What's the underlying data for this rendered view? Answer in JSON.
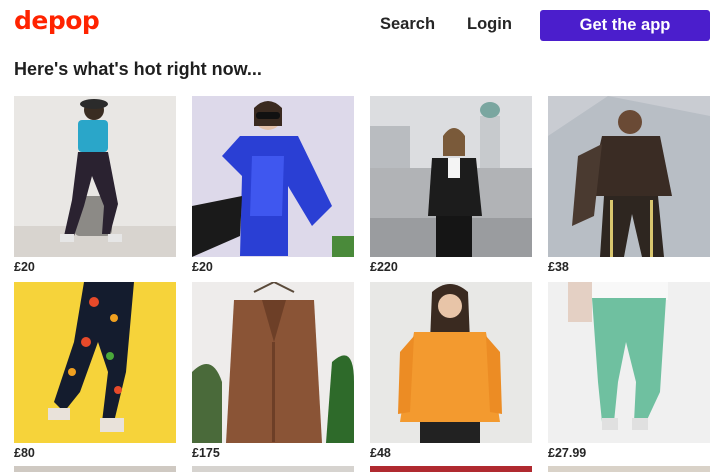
{
  "header": {
    "logo": "depop",
    "nav": [
      {
        "label": "Search"
      },
      {
        "label": "Login"
      }
    ],
    "cta": "Get the app"
  },
  "section": {
    "title": "Here's what's hot right now..."
  },
  "products": [
    {
      "price": "£20",
      "description": "woman in blue cropped tee and black trousers sitting on keg"
    },
    {
      "price": "£20",
      "description": "person in blue satin shirt with sunglasses"
    },
    {
      "price": "£220",
      "description": "woman in black puffer jacket on rooftop"
    },
    {
      "price": "£38",
      "description": "person in brown leather jacket and tracksuit"
    },
    {
      "price": "£80",
      "description": "cherry print trousers with platform heels on yellow"
    },
    {
      "price": "£175",
      "description": "brown wool overcoat on hanger"
    },
    {
      "price": "£48",
      "description": "woman in orange half-zip sweatshirt"
    },
    {
      "price": "£27.99",
      "description": "mint green corduroy trousers"
    }
  ],
  "colors": {
    "brand": "#ff2300",
    "cta_bg": "#4b1ecc"
  }
}
